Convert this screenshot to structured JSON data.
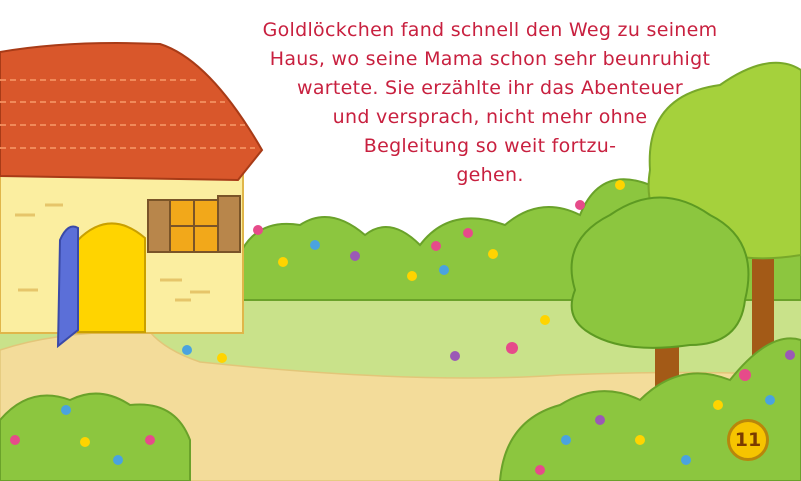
{
  "story": {
    "lines": [
      "Goldlöckchen fand schnell den Weg zu seinem",
      "Haus, wo seine Mama schon sehr beunruhigt",
      "wartete. Sie erzählte ihr das Abenteuer",
      "und versprach, nicht mehr ohne",
      "Begleitung so weit fortzu-",
      "gehen."
    ]
  },
  "page": {
    "number": "11"
  },
  "colors": {
    "text": "#c8203f",
    "roof": "#d9572b",
    "house_wall": "#fbeea0",
    "door": "#ffd400",
    "door_open": "#5b6fd8",
    "shutter": "#b8864b",
    "grass": "#c9e28a",
    "path": "#f3dc9a",
    "bush": "#8cc63f",
    "tree": "#a5d13c",
    "trunk": "#a35a17",
    "badge": "#f6c400"
  }
}
